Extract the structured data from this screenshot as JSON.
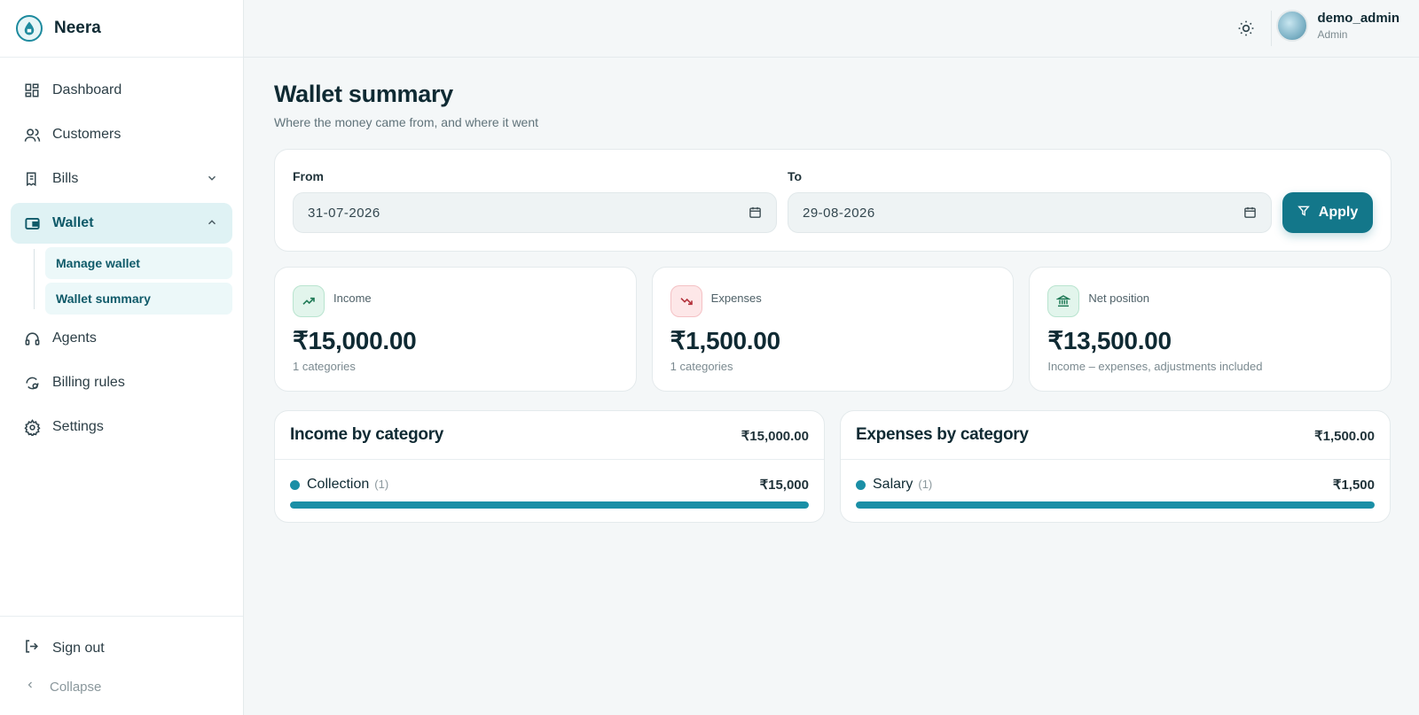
{
  "brand": {
    "name": "Neera"
  },
  "sidebar": {
    "items": [
      {
        "label": "Dashboard",
        "icon": "dashboard-icon"
      },
      {
        "label": "Customers",
        "icon": "users-icon"
      },
      {
        "label": "Bills",
        "icon": "receipt-icon"
      },
      {
        "label": "Wallet",
        "icon": "wallet-icon"
      },
      {
        "label": "Agents",
        "icon": "headset-icon"
      },
      {
        "label": "Billing rules",
        "icon": "rules-icon"
      },
      {
        "label": "Settings",
        "icon": "gear-icon"
      }
    ],
    "wallet_sub": [
      "Manage wallet",
      "Wallet summary"
    ],
    "sign_out": "Sign out",
    "collapse": "Collapse"
  },
  "header": {
    "user_name": "demo_admin",
    "user_role": "Admin"
  },
  "page": {
    "title": "Wallet summary",
    "subtitle": "Where the money came from, and where it went"
  },
  "filters": {
    "from_label": "From",
    "from_value": "31-07-2026",
    "to_label": "To",
    "to_value": "29-08-2026",
    "apply_label": "Apply"
  },
  "stats": [
    {
      "label": "Income",
      "value": "₹15,000.00",
      "note": "1 categories"
    },
    {
      "label": "Expenses",
      "value": "₹1,500.00",
      "note": "1 categories"
    },
    {
      "label": "Net position",
      "value": "₹13,500.00",
      "note": "Income – expenses, adjustments included"
    }
  ],
  "categories": {
    "income": {
      "title": "Income by category",
      "total": "₹15,000.00",
      "rows": [
        {
          "name": "Collection",
          "count": "(1)",
          "amount": "₹15,000",
          "share": 1.0
        }
      ]
    },
    "expenses": {
      "title": "Expenses by category",
      "total": "₹1,500.00",
      "rows": [
        {
          "name": "Salary",
          "count": "(1)",
          "amount": "₹1,500",
          "share": 1.0
        }
      ]
    }
  },
  "colors": {
    "accent": "#13778a",
    "bar": "#1a8fa6",
    "active_bg": "#dff2f4"
  }
}
